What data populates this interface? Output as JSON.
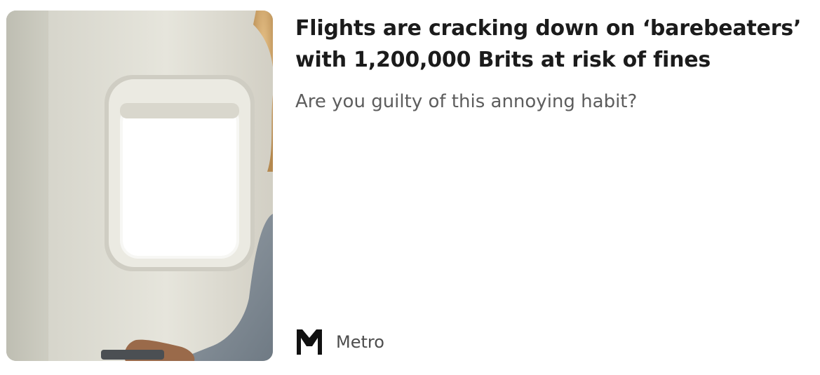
{
  "article": {
    "headline": "Flights are cracking down on ‘barebeaters’ with 1,200,000 Brits at risk of fines",
    "subtitle": "Are you guilty of this annoying habit?",
    "source": {
      "name": "Metro",
      "logo_icon": "metro-logo-icon"
    },
    "image": {
      "icon": "airplane-window-photo"
    }
  },
  "colors": {
    "headline": "#1b1b1b",
    "subtitle": "#5d5d5d",
    "source": "#4d4d4d",
    "background": "#ffffff"
  }
}
